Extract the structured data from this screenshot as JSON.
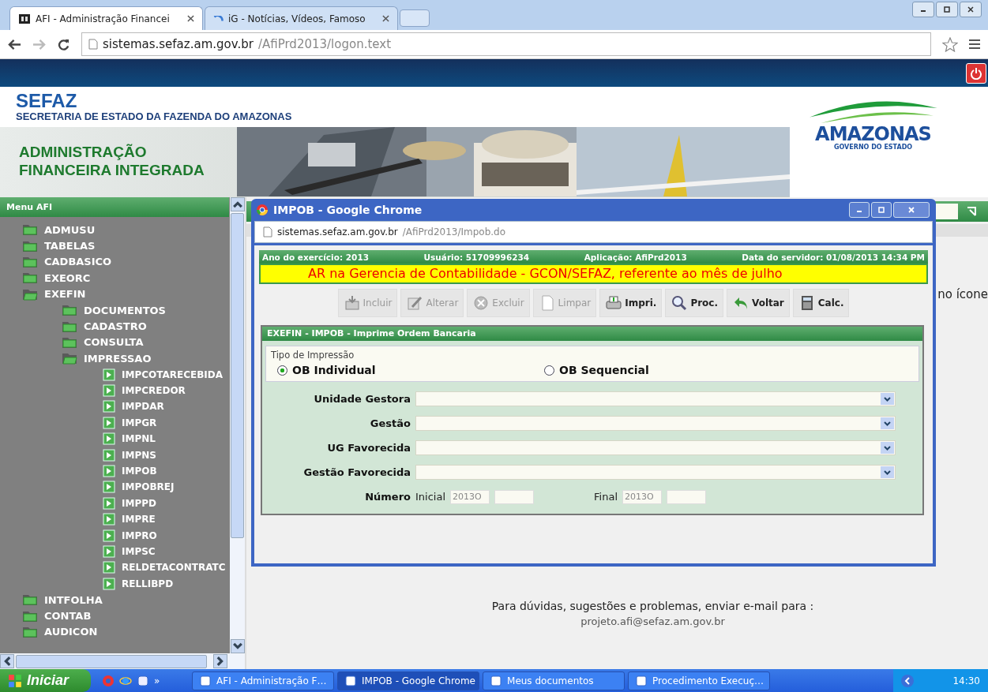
{
  "browser": {
    "tabs": [
      {
        "title": "AFI - Administração Financei",
        "selected": true
      },
      {
        "title": "iG - Notícias, Vídeos, Famoso",
        "selected": false
      }
    ],
    "url_host": "sistemas.sefaz.am.gov.br",
    "url_path": "/AfiPrd2013/logon.text"
  },
  "header": {
    "title": "SEFAZ",
    "subtitle": "SECRETARIA DE ESTADO DA FAZENDA DO AMAZONAS",
    "system_name": [
      "ADMINISTRAÇÃO",
      "FINANCEIRA INTEGRADA"
    ],
    "logo": {
      "name": "AMAZONAS",
      "tagline": "GOVERNO DO ESTADO"
    }
  },
  "sidebar": {
    "title": "Menu AFI",
    "items": [
      {
        "label": "ADMUSU",
        "kind": "folder",
        "expanded": false
      },
      {
        "label": "TABELAS",
        "kind": "folder",
        "expanded": false
      },
      {
        "label": "CADBASICO",
        "kind": "folder",
        "expanded": false
      },
      {
        "label": "EXEORC",
        "kind": "folder",
        "expanded": false
      },
      {
        "label": "EXEFIN",
        "kind": "folder",
        "expanded": true,
        "children": [
          {
            "label": "DOCUMENTOS",
            "kind": "folder",
            "expanded": false
          },
          {
            "label": "CADASTRO",
            "kind": "folder",
            "expanded": false
          },
          {
            "label": "CONSULTA",
            "kind": "folder",
            "expanded": false
          },
          {
            "label": "IMPRESSAO",
            "kind": "folder",
            "expanded": true,
            "children": [
              {
                "label": "IMPCOTARECEBIDA",
                "kind": "page"
              },
              {
                "label": "IMPCREDOR",
                "kind": "page"
              },
              {
                "label": "IMPDAR",
                "kind": "page"
              },
              {
                "label": "IMPGR",
                "kind": "page"
              },
              {
                "label": "IMPNL",
                "kind": "page"
              },
              {
                "label": "IMPNS",
                "kind": "page"
              },
              {
                "label": "IMPOB",
                "kind": "page"
              },
              {
                "label": "IMPOBREJ",
                "kind": "page"
              },
              {
                "label": "IMPPD",
                "kind": "page"
              },
              {
                "label": "IMPRE",
                "kind": "page"
              },
              {
                "label": "IMPRO",
                "kind": "page"
              },
              {
                "label": "IMPSC",
                "kind": "page"
              },
              {
                "label": "RELDETACONTRATC",
                "kind": "page"
              },
              {
                "label": "RELLIBPD",
                "kind": "page"
              }
            ]
          }
        ]
      },
      {
        "label": "INTFOLHA",
        "kind": "folder",
        "expanded": false
      },
      {
        "label": "CONTAB",
        "kind": "folder",
        "expanded": false
      },
      {
        "label": "AUDICON",
        "kind": "folder",
        "expanded": false
      }
    ]
  },
  "page": {
    "side_text": "no ícone",
    "footer": {
      "text": "Para dúvidas, sugestões e problemas, enviar e-mail para :",
      "email": "projeto.afi@sefaz.am.gov.br"
    }
  },
  "popup": {
    "title": "IMPOB - Google Chrome",
    "url_host": "sistemas.sefaz.am.gov.br",
    "url_path": "/AfiPrd2013/Impob.do",
    "info": [
      "Ano do exercício: 2013",
      "Usuário: 51709996234",
      "Aplicação: AfiPrd2013",
      "Data do servidor: 01/08/2013 14:34 PM"
    ],
    "notice": "AR na Gerencia de Contabilidade - GCON/SEFAZ, referente ao mês de julho",
    "toolbar": [
      {
        "label": "Incluir",
        "disabled": true
      },
      {
        "label": "Alterar",
        "disabled": true
      },
      {
        "label": "Excluir",
        "disabled": true
      },
      {
        "label": "Limpar",
        "disabled": true
      },
      {
        "label": "Impri.",
        "disabled": false
      },
      {
        "label": "Proc.",
        "disabled": false
      },
      {
        "label": "Voltar",
        "disabled": false
      },
      {
        "label": "Calc.",
        "disabled": false
      }
    ],
    "panel_title": "EXEFIN - IMPOB - Imprime Ordem Bancaria",
    "print_type": {
      "legend": "Tipo de Impressão",
      "options": [
        {
          "label": "OB Individual",
          "selected": true
        },
        {
          "label": "OB Sequencial",
          "selected": false
        }
      ]
    },
    "selects": [
      {
        "label": "Unidade Gestora"
      },
      {
        "label": "Gestão"
      },
      {
        "label": "UG Favorecida"
      },
      {
        "label": "Gestão Favorecida"
      }
    ],
    "number": {
      "label": "Número",
      "start_label": "Inicial",
      "start_value": "2013O",
      "end_label": "Final",
      "end_value": "2013O"
    }
  },
  "taskbar": {
    "start": "Iniciar",
    "more": "»",
    "tasks": [
      {
        "label": "AFI - Administração F…",
        "selected": false
      },
      {
        "label": "IMPOB - Google Chrome",
        "selected": true
      },
      {
        "label": "Meus documentos",
        "selected": false
      },
      {
        "label": "Procedimento Execuç…",
        "selected": false
      }
    ],
    "clock": "14:30"
  }
}
